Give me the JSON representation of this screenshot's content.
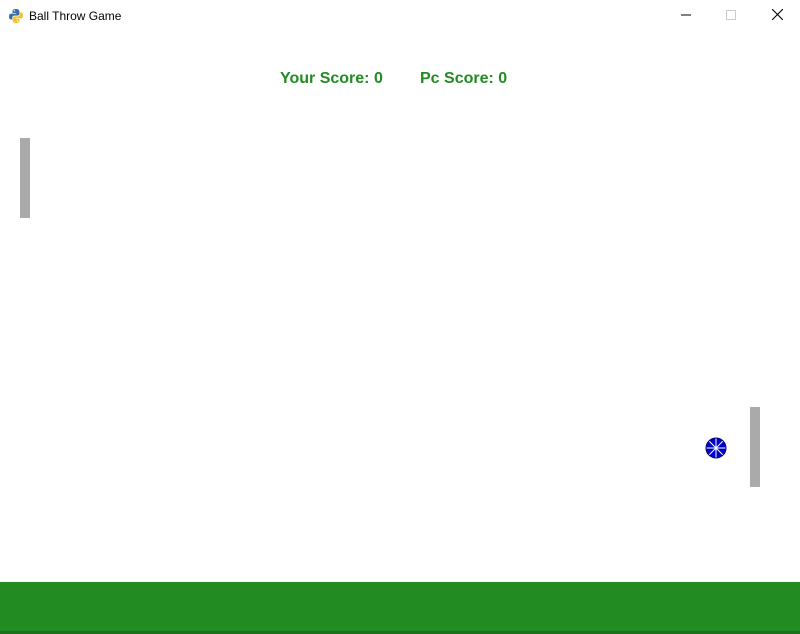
{
  "window": {
    "title": "Ball Throw Game",
    "app_icon": "python-icon",
    "controls": {
      "minimize_icon": "minimize-icon",
      "maximize_icon": "maximize-icon",
      "close_icon": "close-icon"
    }
  },
  "scoreboard": {
    "player_score_text": "Your Score: 0",
    "pc_score_text": "Pc Score: 0",
    "player_score": 0,
    "pc_score": 0
  },
  "colors": {
    "background": "#ffffff",
    "score_text": "#228b22",
    "ground": "#228b22",
    "paddle": "#aaaaaa",
    "ball": "#0000cc"
  }
}
